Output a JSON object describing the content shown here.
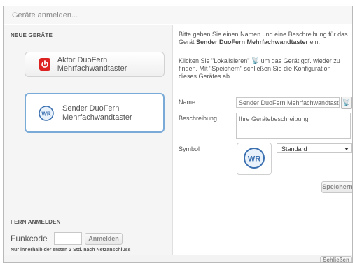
{
  "dialog": {
    "title": "Geräte anmelden..."
  },
  "new_devices": {
    "heading": "NEUE GERÄTE",
    "items": [
      {
        "label": "Aktor DuoFern Mehrfachwandtaster",
        "icon": "power-icon",
        "selected": false
      },
      {
        "label": "Sender DuoFern Mehrfachwandtaster",
        "icon": "wr-logo-icon",
        "selected": true
      }
    ]
  },
  "fern_anmelden": {
    "heading": "FERN ANMELDEN",
    "funkcode_label": "Funkcode",
    "funkcode_value": "",
    "button_label": "Anmelden",
    "hint": "Nur innerhalb der ersten 2 Std. nach Netzanschluss"
  },
  "right": {
    "intro_prefix": "Bitte geben Sie einen Namen und eine Beschreibung für das Gerät ",
    "intro_device": "Sender DuoFern Mehrfachwandtaster",
    "intro_suffix": " ein.",
    "locate_prefix": "Klicken Sie \"Lokalisieren\" ",
    "locate_suffix": " um das Gerät ggf. wieder zu finden. Mit \"Speichern\" schließen Sie die Konfiguration dieses Gerätes ab.",
    "name_label": "Name",
    "name_value": "Sender DuoFern Mehrfachwandtaster",
    "description_label": "Beschreibung",
    "description_placeholder": "Ihre Gerätebeschreibung",
    "symbol_label": "Symbol",
    "symbol_selected": "Standard",
    "save_label": "Speichern"
  },
  "footer": {
    "close_label": "Schließen"
  },
  "colors": {
    "accent_border": "#7aaad8",
    "power_red": "#d22222",
    "logo_blue": "#3a6fb0"
  }
}
